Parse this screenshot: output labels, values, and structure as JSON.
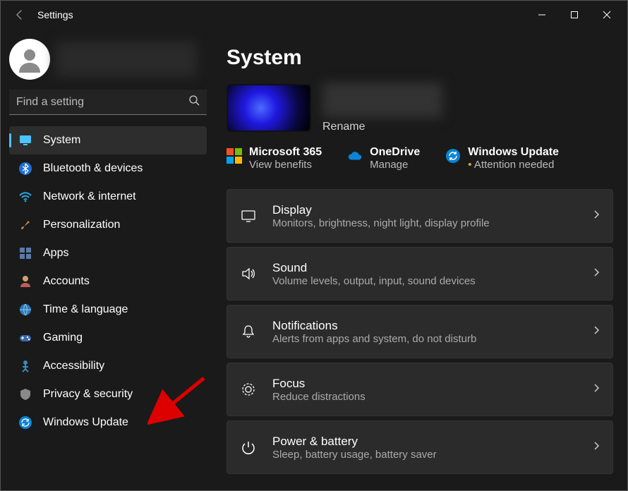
{
  "window": {
    "title": "Settings"
  },
  "search": {
    "placeholder": "Find a setting"
  },
  "sidebar": {
    "items": [
      {
        "id": "system",
        "label": "System",
        "icon": "monitor",
        "active": true
      },
      {
        "id": "bluetooth",
        "label": "Bluetooth & devices",
        "icon": "bluetooth",
        "active": false
      },
      {
        "id": "network",
        "label": "Network & internet",
        "icon": "wifi",
        "active": false
      },
      {
        "id": "personalization",
        "label": "Personalization",
        "icon": "brush",
        "active": false
      },
      {
        "id": "apps",
        "label": "Apps",
        "icon": "grid",
        "active": false
      },
      {
        "id": "accounts",
        "label": "Accounts",
        "icon": "person",
        "active": false
      },
      {
        "id": "time",
        "label": "Time & language",
        "icon": "globe",
        "active": false
      },
      {
        "id": "gaming",
        "label": "Gaming",
        "icon": "gamepad",
        "active": false
      },
      {
        "id": "accessibility",
        "label": "Accessibility",
        "icon": "person2",
        "active": false
      },
      {
        "id": "privacy",
        "label": "Privacy & security",
        "icon": "shield",
        "active": false
      },
      {
        "id": "update",
        "label": "Windows Update",
        "icon": "sync",
        "active": false
      }
    ]
  },
  "page": {
    "heading": "System",
    "device": {
      "rename_label": "Rename"
    },
    "status": {
      "m365": {
        "title": "Microsoft 365",
        "sub": "View benefits"
      },
      "onedrive": {
        "title": "OneDrive",
        "sub": "Manage"
      },
      "update": {
        "title": "Windows Update",
        "sub": "Attention needed"
      }
    },
    "cards": [
      {
        "id": "display",
        "title": "Display",
        "sub": "Monitors, brightness, night light, display profile",
        "icon": "monitor"
      },
      {
        "id": "sound",
        "title": "Sound",
        "sub": "Volume levels, output, input, sound devices",
        "icon": "speaker"
      },
      {
        "id": "notifications",
        "title": "Notifications",
        "sub": "Alerts from apps and system, do not disturb",
        "icon": "bell"
      },
      {
        "id": "focus",
        "title": "Focus",
        "sub": "Reduce distractions",
        "icon": "target"
      },
      {
        "id": "power",
        "title": "Power & battery",
        "sub": "Sleep, battery usage, battery saver",
        "icon": "power"
      }
    ]
  },
  "annotation": {
    "arrow_target": "sidebar-item-update"
  }
}
